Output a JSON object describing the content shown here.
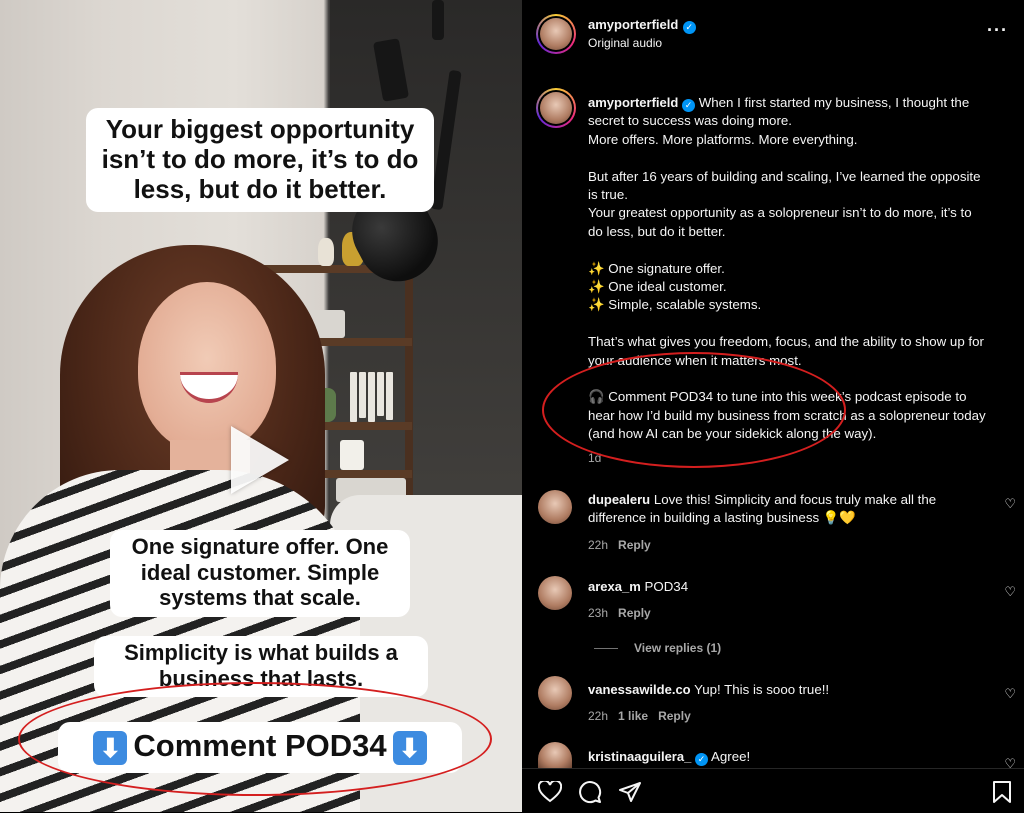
{
  "video": {
    "caption_top": "Your biggest opportunity isn’t to do more, it’s to do less, but do it better.",
    "caption_mid": "One signature offer. One ideal customer. Simple systems that scale.",
    "caption_low": "Simplicity is what builds a business that lasts.",
    "caption_cta": "Comment POD34",
    "arrow_glyph": "⬇"
  },
  "header": {
    "username": "amyporterfield",
    "audio": "Original audio",
    "more": "···"
  },
  "post": {
    "username": "amyporterfield",
    "lines": [
      "When I first started my business, I thought the",
      "secret to success was doing more.",
      "More offers. More platforms. More everything.",
      "",
      "But after 16 years of building and scaling, I’ve learned the opposite",
      "is true.",
      "Your greatest opportunity as a solopreneur isn’t to do more, it’s to",
      "do less, but do it better.",
      "",
      "✨ One signature offer.",
      "✨ One ideal customer.",
      "✨ Simple, scalable systems.",
      "",
      "That’s what gives you freedom, focus, and the ability to show up for",
      "your audience when it matters most.",
      "",
      "🎧 Comment POD34 to tune into this week’s podcast episode to",
      "hear how I’d build my business from scratch as a solopreneur today",
      "(and how AI can be your sidekick along the way)."
    ],
    "time": "1d"
  },
  "comments": [
    {
      "user": "dupealeru",
      "text": "Love this! Simplicity and focus truly make all the",
      "text2": "difference in building a lasting business 💡💛",
      "time": "22h",
      "likes": "",
      "reply": "Reply"
    },
    {
      "user": "arexa_m",
      "text": "POD34",
      "text2": "",
      "time": "23h",
      "likes": "",
      "reply": "Reply",
      "view_replies": "View replies (1)"
    },
    {
      "user": "vanessawilde.co",
      "text": "Yup! This is sooo true!!",
      "text2": "",
      "time": "22h",
      "likes": "1 like",
      "reply": "Reply"
    },
    {
      "user": "kristinaaguilera_",
      "text": "Agree!",
      "text2": "",
      "time": "",
      "likes": "",
      "reply": ""
    }
  ],
  "actions": {
    "like_icon": "heart-icon",
    "comment_icon": "comment-icon",
    "share_icon": "share-icon",
    "save_icon": "bookmark-icon"
  },
  "colors": {
    "annotation": "#d41f1f",
    "verified": "#0095f6",
    "background": "#000000"
  }
}
